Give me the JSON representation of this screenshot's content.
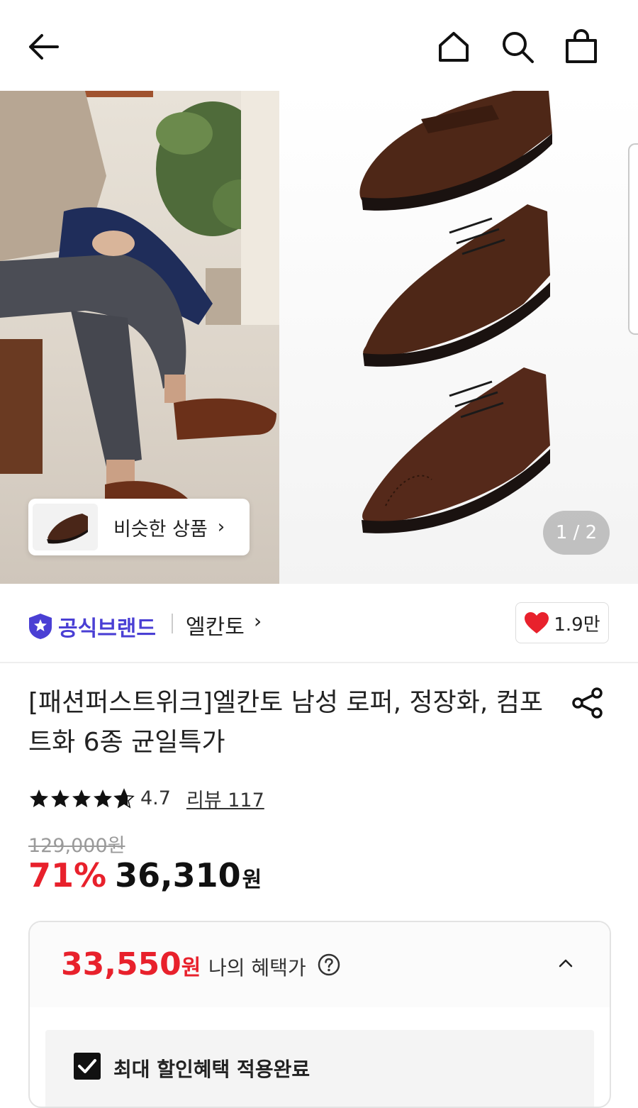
{
  "nav": {
    "back_icon": "arrow-left-icon",
    "home_icon": "home-icon",
    "search_icon": "search-icon",
    "cart_icon": "shopping-bag-icon"
  },
  "gallery": {
    "similar_label": "비슷한 상품",
    "similar_chevron": "›",
    "pager": "1 / 2"
  },
  "brand": {
    "badge_label": "공식브랜드",
    "name": "엘칸토",
    "chevron": "›",
    "like_count": "1.9만"
  },
  "product": {
    "title": "[패션퍼스트위크]엘칸토 남성 로퍼, 정장화, 컴포트화 6종 균일특가",
    "rating": "4.7",
    "rating_stars": 4.7,
    "review_link": "리뷰 117",
    "original_price": "129,000원",
    "discount": "71%",
    "price": "36,310",
    "currency": "원"
  },
  "benefit": {
    "price": "33,550",
    "currency": "원",
    "label": "나의 혜택가",
    "checkbox_label": "최대 할인혜택 적용완료"
  },
  "colors": {
    "accent_red": "#e8212c",
    "brand_purple": "#4a3fd4"
  }
}
